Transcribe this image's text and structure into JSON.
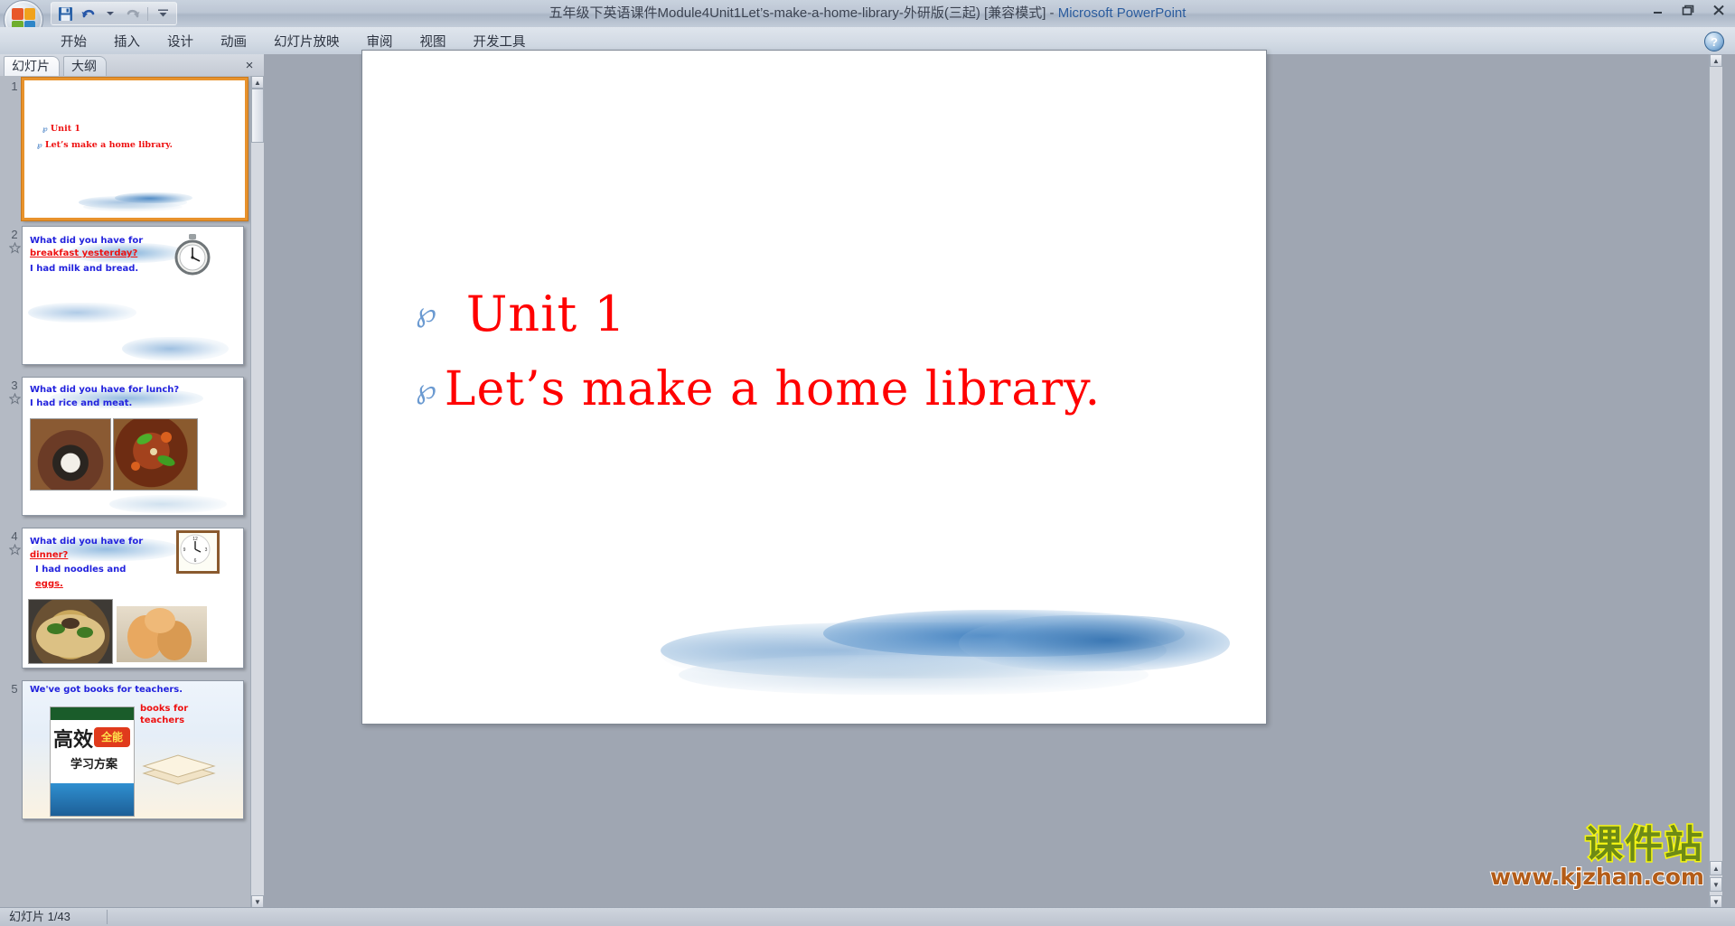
{
  "window": {
    "title": "五年级下英语课件Module4Unit1Let’s-make-a-home-library-外研版(三起) [兼容模式]",
    "separator": "-",
    "app_name": "Microsoft PowerPoint",
    "minimize_label": "最小化",
    "restore_label": "向下还原",
    "close_label": "关闭"
  },
  "quick_access": {
    "save_icon": "save-icon",
    "undo_icon": "undo-icon",
    "redo_icon": "redo-icon",
    "customize_icon": "chevron-down-icon"
  },
  "ribbon": {
    "tabs": [
      {
        "label": "开始"
      },
      {
        "label": "插入"
      },
      {
        "label": "设计"
      },
      {
        "label": "动画"
      },
      {
        "label": "幻灯片放映"
      },
      {
        "label": "审阅"
      },
      {
        "label": "视图"
      },
      {
        "label": "开发工具"
      }
    ],
    "help_label": "?"
  },
  "left_pane": {
    "tabs": [
      {
        "label": "幻灯片",
        "active": true
      },
      {
        "label": "大纲",
        "active": false
      }
    ],
    "close_label": "×",
    "thumbnails": [
      {
        "number": "1",
        "has_animation": false,
        "selected": true,
        "lines": [
          {
            "text": "Unit 1",
            "color": "#ee1111"
          },
          {
            "text": "Let’s make a home library.",
            "color": "#ee1111"
          }
        ]
      },
      {
        "number": "2",
        "has_animation": true,
        "selected": false,
        "lines": [
          {
            "text": "What did you have for",
            "color": "#2222dd"
          },
          {
            "text": "breakfast yesterday?",
            "color": "#ee1111"
          },
          {
            "text": "I had milk and bread.",
            "color": "#2222dd"
          }
        ],
        "image_names": [
          "stopwatch-image"
        ]
      },
      {
        "number": "3",
        "has_animation": true,
        "selected": false,
        "lines": [
          {
            "text": "What did you have for lunch?",
            "color": "#2222dd"
          },
          {
            "text": "I had rice and meat.",
            "color": "#2222dd"
          }
        ],
        "image_names": [
          "rice-bowl-image",
          "braised-pork-image"
        ]
      },
      {
        "number": "4",
        "has_animation": true,
        "selected": false,
        "lines": [
          {
            "text": "What did you have for",
            "color": "#2222dd"
          },
          {
            "text": "dinner?",
            "color": "#ee1111"
          },
          {
            "text": "I had noodles and",
            "color": "#2222dd"
          },
          {
            "text": "eggs.",
            "color": "#ee1111"
          }
        ],
        "image_names": [
          "wall-clock-image",
          "noodles-image",
          "eggs-image"
        ]
      },
      {
        "number": "5",
        "has_animation": false,
        "selected": false,
        "lines": [
          {
            "text": "We've got books for teachers.",
            "color": "#2222dd"
          },
          {
            "text": "books for teachers",
            "color": "#ee1111"
          }
        ],
        "image_names": [
          "textbook-cover-image",
          "book-stack-image"
        ]
      }
    ]
  },
  "slide": {
    "bullet_glyph": "℘",
    "bullet_color": "#6b9ad1",
    "text_color": "#ff0000",
    "lines": [
      {
        "text": "Unit 1"
      },
      {
        "text": "Let’s make a home library."
      }
    ],
    "watermark": {
      "brand": "课件站",
      "url": "www.kjzhan.com",
      "brand_color": "#6d8a16",
      "brand_stroke": "#f5f512",
      "url_color": "#b35c18"
    }
  },
  "status_bar": {
    "slide_counter": "幻灯片 1/43"
  },
  "scrollbars": {
    "up_arrow": "▲",
    "down_arrow": "▼",
    "prev_slide": "▲",
    "next_slide": "▼"
  }
}
